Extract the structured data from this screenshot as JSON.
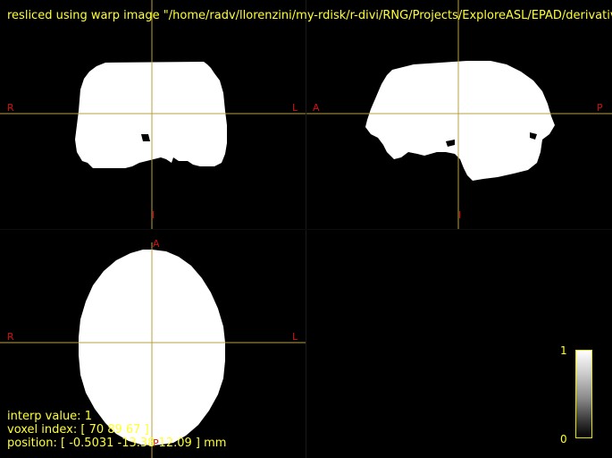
{
  "title": "resliced using warp image \"/home/radv/llorenzini/my-rdisk/r-divi/RNG/Projects/ExploreASL/EPAD/derivatives/",
  "views": {
    "coronal": {
      "left": "R",
      "right": "L",
      "bottom": "I"
    },
    "sagittal": {
      "left": "A",
      "right": "P",
      "bottom": "I"
    },
    "axial": {
      "top": "A",
      "left": "R",
      "right": "L",
      "bottom": "P"
    }
  },
  "info": {
    "interp": "interp value: 1",
    "voxel": "voxel index: [ 70 89 67 ]",
    "position": "position: [ -0.5031 -13.38 12.09 ] mm"
  },
  "colorbar": {
    "max": "1",
    "min": "0"
  },
  "colors": {
    "text": "#ffff33",
    "orient": "#d01010",
    "crosshair": "#b8a040"
  }
}
